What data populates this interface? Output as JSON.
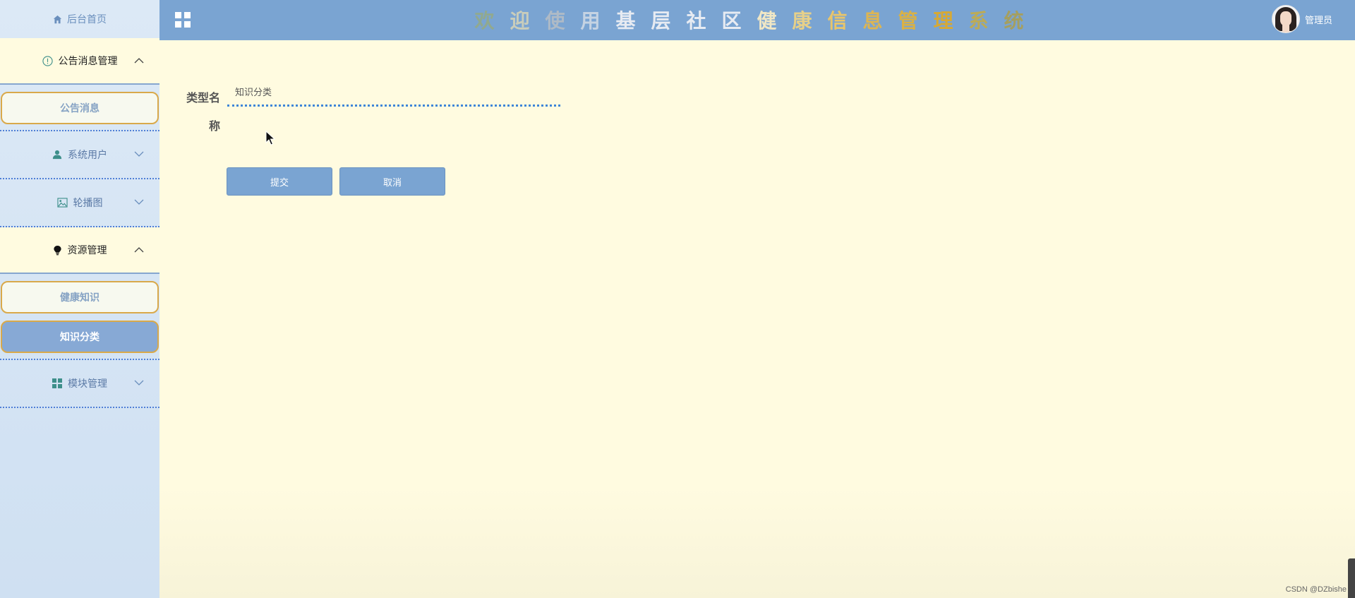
{
  "sidebar": {
    "home_label": "后台首页",
    "groups": [
      {
        "label": "公告消息管理",
        "icon": "info-circle-icon",
        "expanded": true,
        "items": [
          {
            "label": "公告消息",
            "active": false
          }
        ]
      },
      {
        "label": "系统用户",
        "icon": "user-icon",
        "expanded": false,
        "items": []
      },
      {
        "label": "轮播图",
        "icon": "image-icon",
        "expanded": false,
        "items": []
      },
      {
        "label": "资源管理",
        "icon": "bulb-icon",
        "expanded": true,
        "items": [
          {
            "label": "健康知识",
            "active": false
          },
          {
            "label": "知识分类",
            "active": true
          }
        ]
      },
      {
        "label": "模块管理",
        "icon": "grid-icon",
        "expanded": false,
        "items": []
      }
    ]
  },
  "header": {
    "title_chars": [
      "欢",
      "迎",
      "使",
      "用",
      "基",
      "层",
      "社",
      "区",
      "健",
      "康",
      "信",
      "息",
      "管",
      "理",
      "系",
      "统"
    ],
    "title_colors": [
      "#91a98f",
      "#c9cdbb",
      "#aebac6",
      "#c5d3e3",
      "#e7ebf2",
      "#e7ebf2",
      "#e7ebf2",
      "#e7ebf2",
      "#f0e7c5",
      "#e6d089",
      "#e8c56b",
      "#ddb552",
      "#d9b146",
      "#d7a934",
      "#bcab57",
      "#a59f5f"
    ],
    "user_name": "管理员"
  },
  "form": {
    "label": "类型名称",
    "label_line1": "类型名",
    "label_line2": "称",
    "value": "知识分类",
    "submit_label": "提交",
    "cancel_label": "取消"
  },
  "watermark": "CSDN @DZbishe"
}
